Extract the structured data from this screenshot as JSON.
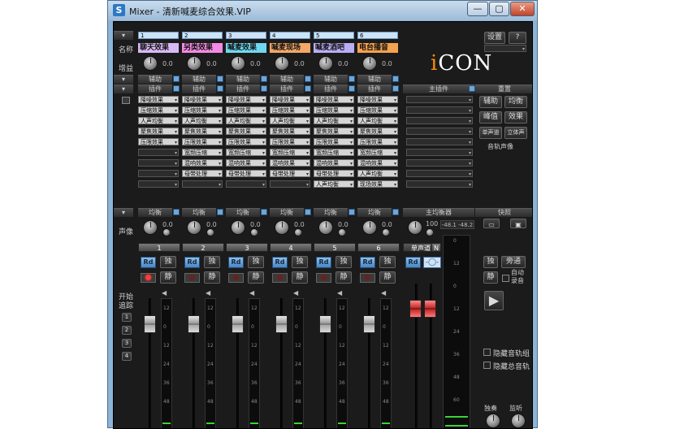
{
  "window": {
    "title": "Mixer - 清新喊麦综合效果.VIP",
    "icon": "S",
    "buttons": [
      "—",
      "▢",
      "✕"
    ]
  },
  "top": {
    "channel_selects": [
      "1",
      "1",
      "1",
      "1",
      "1",
      "1"
    ],
    "name_label": "名称",
    "gain_label": "增益",
    "settings_button": "设置",
    "help_button": "?",
    "brand": "iCON",
    "colors": {
      "accent": "#6ea6d6",
      "red_fader": "#d13030",
      "meter_green": "#39d339"
    }
  },
  "channels": [
    {
      "num": "1",
      "name": "聊天效果",
      "name_color": "#d9b9f5",
      "gain": "0.0",
      "aux": "辅助",
      "inserts": "插件",
      "eq": "均衡",
      "pan": "0.0",
      "rd": "Rd",
      "solo": "独",
      "mute": "静",
      "rec_on": true,
      "plugins": [
        "降噪效果",
        "压缩效果",
        "人声均衡",
        "聚焦效果",
        "压限效果",
        "",
        "",
        "",
        ""
      ]
    },
    {
      "num": "2",
      "name": "另类效果",
      "name_color": "#f58ae4",
      "gain": "0.0",
      "aux": "辅助",
      "inserts": "插件",
      "eq": "均衡",
      "pan": "0.0",
      "rd": "Rd",
      "solo": "独",
      "mute": "静",
      "rec_on": false,
      "plugins": [
        "降噪效果",
        "压缩效果",
        "人声均衡",
        "聚焦效果",
        "压限效果",
        "宽频压缩",
        "混响效果",
        "母带处理",
        ""
      ]
    },
    {
      "num": "3",
      "name": "喊麦效果",
      "name_color": "#6fd8f0",
      "gain": "0.0",
      "aux": "辅助",
      "inserts": "插件",
      "eq": "均衡",
      "pan": "0.0",
      "rd": "Rd",
      "solo": "独",
      "mute": "静",
      "rec_on": false,
      "plugins": [
        "降噪效果",
        "压缩效果",
        "人声均衡",
        "聚焦效果",
        "压限效果",
        "宽频压缩",
        "混响效果",
        "母带处理",
        ""
      ]
    },
    {
      "num": "4",
      "name": "喊麦现场",
      "name_color": "#f3a867",
      "gain": "0.0",
      "aux": "辅助",
      "inserts": "插件",
      "eq": "均衡",
      "pan": "0.0",
      "rd": "Rd",
      "solo": "独",
      "mute": "静",
      "rec_on": false,
      "plugins": [
        "降噪效果",
        "压缩效果",
        "人声均衡",
        "聚焦效果",
        "压限效果",
        "宽频压缩",
        "混响效果",
        "母带处理",
        ""
      ]
    },
    {
      "num": "5",
      "name": "喊麦酒吧",
      "name_color": "#b9aef5",
      "gain": "0.0",
      "aux": "辅助",
      "inserts": "插件",
      "eq": "均衡",
      "pan": "0.0",
      "rd": "Rd",
      "solo": "独",
      "mute": "静",
      "rec_on": false,
      "plugins": [
        "降噪效果",
        "压缩效果",
        "人声均衡",
        "聚焦效果",
        "压限效果",
        "宽频压缩",
        "混响效果",
        "母带处理",
        "人声均衡"
      ]
    },
    {
      "num": "6",
      "name": "电台播音",
      "name_color": "#f5a34f",
      "gain": "0.0",
      "aux": "辅助",
      "inserts": "插件",
      "eq": "均衡",
      "pan": "0.0",
      "rd": "Rd",
      "solo": "独",
      "mute": "静",
      "rec_on": false,
      "plugins": [
        "降噪效果",
        "压缩效果",
        "人声均衡",
        "聚焦效果",
        "压限效果",
        "宽频压缩",
        "混响效果",
        "人声均衡",
        "现场效果"
      ]
    }
  ],
  "master": {
    "inserts": "主插件",
    "eq": "主均衡器",
    "pan": "100",
    "stereo_label": "单声道",
    "n_label": "N",
    "rd": "Rd",
    "meter_readout": "-48.1 -48.2"
  },
  "right_panel": {
    "header": "重置",
    "buttons": [
      "辅助",
      "均衡",
      "峰值",
      "效果",
      "单声道",
      "立体声"
    ],
    "track_sound": "音轨声像",
    "snapshot_header": "快照",
    "solo": "独",
    "bypass": "旁通",
    "mute": "静",
    "auto_record": "自动录音",
    "hide_groups": "隐藏音轨组",
    "hide_master": "隐藏总音轨",
    "solo_label": "独奏",
    "monitor_label": "监听"
  },
  "left_panel": {
    "pan_label": "声像",
    "start_tracking": "开始追踪",
    "track_buttons": [
      "1",
      "2",
      "3",
      "4"
    ]
  },
  "meter_scale": [
    "0",
    "12",
    "0",
    "12",
    "24",
    "36",
    "48",
    "60"
  ]
}
